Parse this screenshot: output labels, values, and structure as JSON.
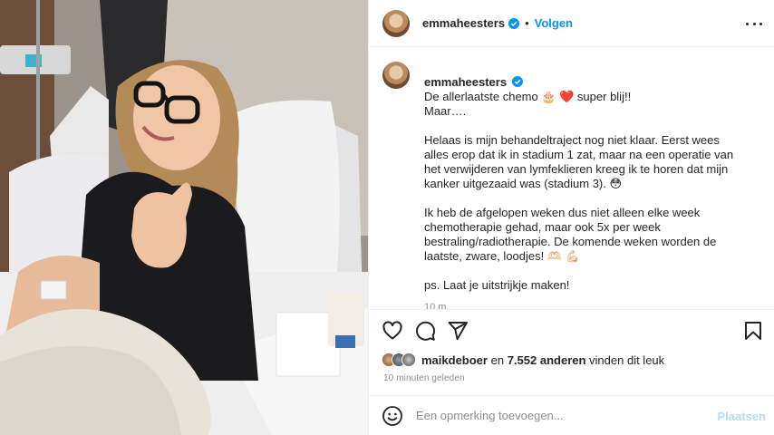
{
  "post": {
    "username": "emmaheesters",
    "follow_label": "Volgen",
    "separator": "•",
    "caption_lines": "De allerlaatste chemo 🎂 ❤️ super blij!!\nMaar….\n\nHelaas is mijn behandeltraject nog niet klaar. Eerst wees alles erop dat ik in stadium 1 zat, maar na een operatie van het verwijderen van lymfeklieren kreeg ik te horen dat mijn kanker uitgezaaid was (stadium 3). 😳\n\nIk heb de afgelopen weken dus niet alleen elke week chemotherapie gehad, maar ook 5x per week bestraling/radiotherapie. De komende weken worden de laatste, zware, loodjes! 🫶🏻 💪🏻\n\nps. Laat je uitstrijkje maken!",
    "time_short": "10 m."
  },
  "likes": {
    "user": "maikdeboer",
    "connector": "en",
    "count_text": "7.552 anderen",
    "suffix": "vinden dit leuk"
  },
  "time_ago": "10 minuten geleden",
  "comment": {
    "placeholder": "Een opmerking toevoegen...",
    "post_label": "Plaatsen"
  },
  "icons": {
    "verified": "verified-badge-icon",
    "more": "more-options-icon",
    "like": "heart-icon",
    "comment": "comment-bubble-icon",
    "share": "paper-plane-icon",
    "save": "bookmark-icon",
    "emoji": "smiley-icon"
  },
  "colors": {
    "accent_blue": "#0095f6",
    "post_disabled": "#b3dbff",
    "muted_text": "#8e8e8e",
    "divider": "#efefef"
  }
}
